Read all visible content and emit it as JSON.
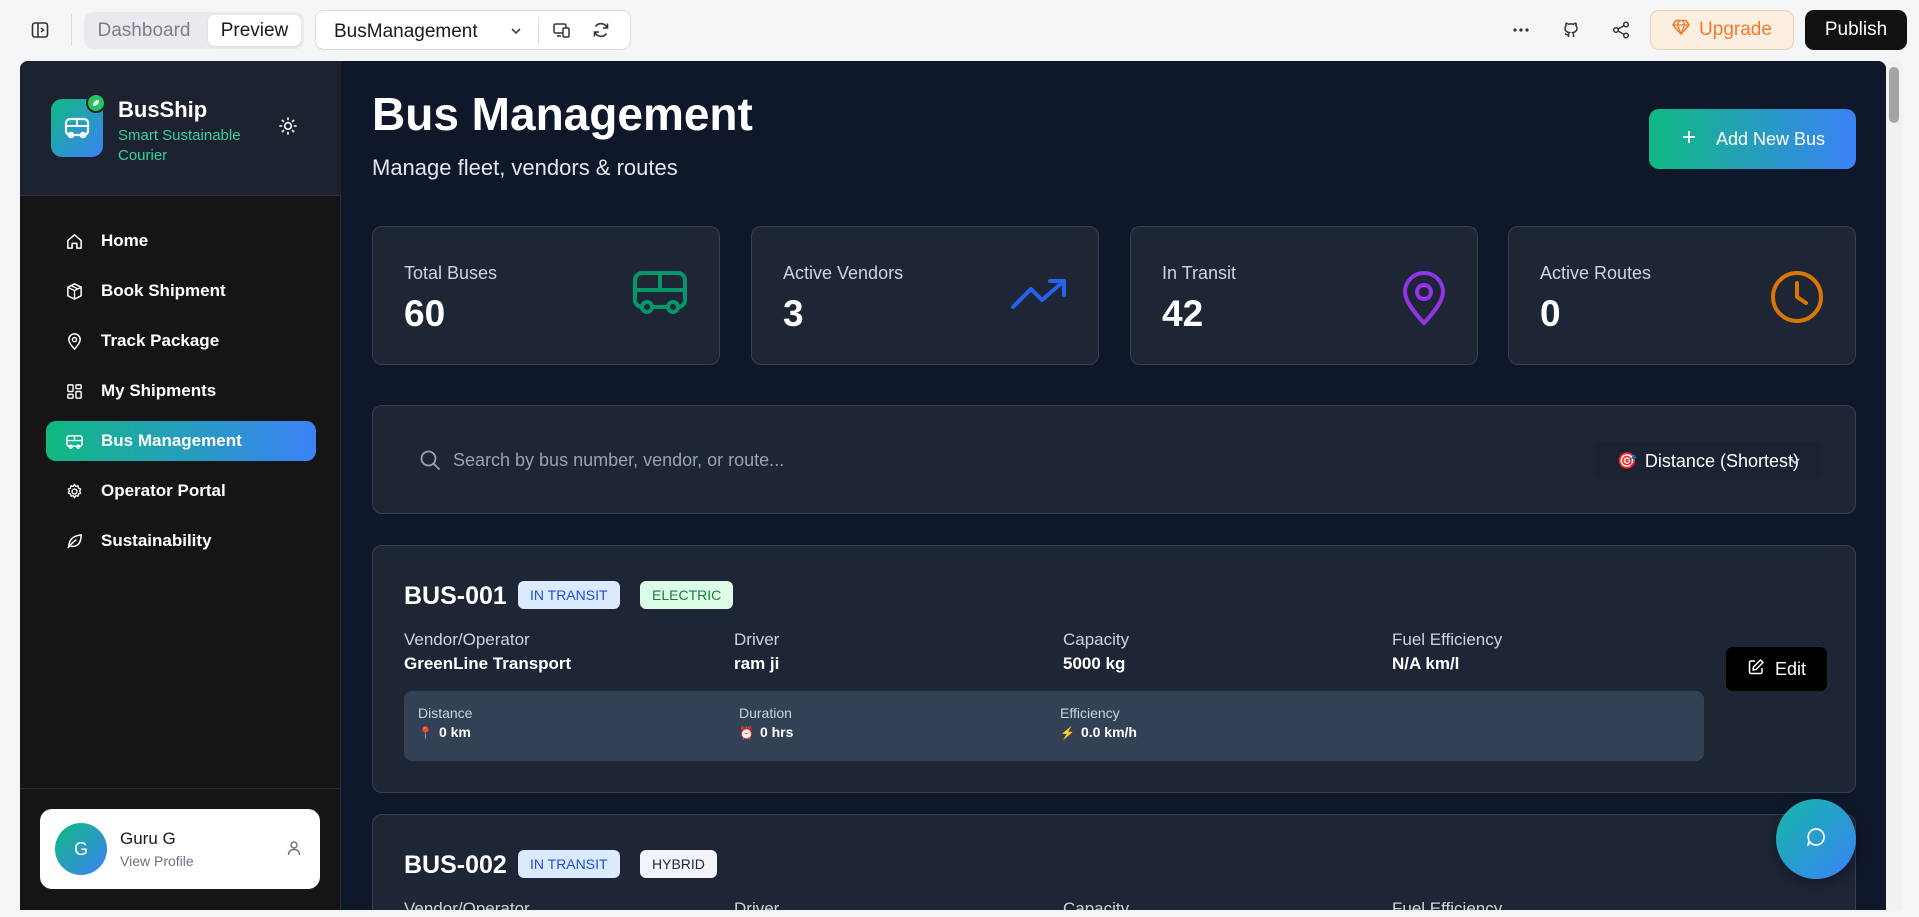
{
  "editor": {
    "tabs": [
      "Dashboard",
      "Preview"
    ],
    "project_name": "BusManagement",
    "upgrade_label": "Upgrade",
    "publish_label": "Publish"
  },
  "brand": {
    "name": "BusShip",
    "tagline": "Smart Sustainable Courier"
  },
  "nav": {
    "items": [
      {
        "label": "Home",
        "icon": "home-icon"
      },
      {
        "label": "Book Shipment",
        "icon": "package-icon"
      },
      {
        "label": "Track Package",
        "icon": "map-pin-icon"
      },
      {
        "label": "My Shipments",
        "icon": "dashboard-icon"
      },
      {
        "label": "Bus Management",
        "icon": "bus-icon",
        "active": true
      },
      {
        "label": "Operator Portal",
        "icon": "settings-icon"
      },
      {
        "label": "Sustainability",
        "icon": "leaf-icon"
      }
    ]
  },
  "profile": {
    "initial": "G",
    "name": "Guru G",
    "subtitle": "View Profile"
  },
  "page": {
    "title": "Bus Management",
    "subtitle": "Manage fleet, vendors & routes",
    "add_button": "Add New Bus"
  },
  "stats": [
    {
      "label": "Total Buses",
      "value": "60",
      "icon": "bus-icon",
      "color": "#059669"
    },
    {
      "label": "Active Vendors",
      "value": "3",
      "icon": "trending-up-icon",
      "color": "#2563eb"
    },
    {
      "label": "In Transit",
      "value": "42",
      "icon": "map-pin-icon",
      "color": "#9333ea"
    },
    {
      "label": "Active Routes",
      "value": "0",
      "icon": "clock-icon",
      "color": "#d97706"
    }
  ],
  "search": {
    "placeholder": "Search by bus number, vendor, or route...",
    "sort_emoji": "🎯",
    "sort_label": "Distance (Shortest)"
  },
  "buses": [
    {
      "id": "BUS-001",
      "status": "IN TRANSIT",
      "fuel_type": "ELECTRIC",
      "vendor_label": "Vendor/Operator",
      "vendor": "GreenLine Transport",
      "driver_label": "Driver",
      "driver": "ram ji",
      "capacity_label": "Capacity",
      "capacity": "5000 kg",
      "efficiency_label": "Fuel Efficiency",
      "efficiency": "N/A km/l",
      "distance_label": "Distance",
      "distance": "0 km",
      "duration_label": "Duration",
      "duration": "0 hrs",
      "speed_label": "Efficiency",
      "speed": "0.0 km/h",
      "edit_label": "Edit"
    },
    {
      "id": "BUS-002",
      "status": "IN TRANSIT",
      "fuel_type": "HYBRID",
      "vendor_label": "Vendor/Operator",
      "driver_label": "Driver",
      "capacity_label": "Capacity",
      "efficiency_label": "Fuel Efficiency"
    }
  ],
  "emoji": {
    "distance": "📍",
    "duration": "⏰",
    "speed": "⚡"
  }
}
